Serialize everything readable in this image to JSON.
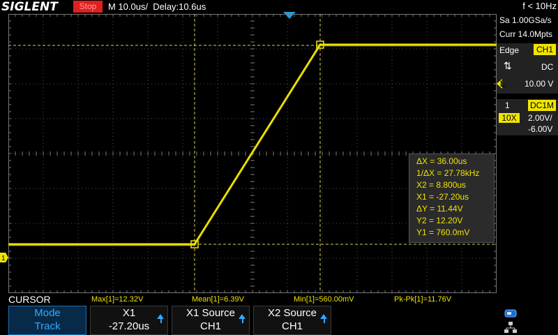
{
  "header": {
    "brand": "SIGLENT",
    "run_state": "Stop",
    "timebase": "M 10.0us/  Delay:10.6us",
    "frequency": "f < 10Hz"
  },
  "acquisition": {
    "sample_rate": "Sa 1.00GSa/s",
    "memory": "Curr 14.0Mpts"
  },
  "trigger": {
    "type": "Edge",
    "source": "CH1",
    "slope_icon": "rise-fall-icon",
    "coupling": "DC",
    "level_label": "L",
    "level": "10.00 V"
  },
  "channel": {
    "number": "1",
    "coupling": "DC1M",
    "probe": "10X",
    "scale": "2.00V/",
    "offset": "-6.00V",
    "marker": "1",
    "color": "#f0e400"
  },
  "cursor_readout": {
    "dx": "ΔX = 36.00us",
    "inv_dx": "1/ΔX = 27.78kHz",
    "x2": "X2 = 8.800us",
    "x1": "X1 = -27.20us",
    "dy": "ΔY = 11.44V",
    "y2": "Y2 = 12.20V",
    "y1": "Y1 = 760.0mV"
  },
  "measurements": {
    "max": "Max[1]=12.32V",
    "mean": "Mean[1]=6.39V",
    "min": "Min[1]=560.00mV",
    "pkpk": "Pk-Pk[1]=11.76V"
  },
  "menu": {
    "title": "CURSOR",
    "buttons": [
      {
        "label": "Mode",
        "value": "Track"
      },
      {
        "label": "X1",
        "value": "-27.20us"
      },
      {
        "label": "X1 Source",
        "value": "CH1"
      },
      {
        "label": "X2 Source",
        "value": "CH1"
      }
    ]
  },
  "colors": {
    "trace": "#f0e400",
    "accent": "#1aa0e6",
    "stop": "#e0201e"
  }
}
